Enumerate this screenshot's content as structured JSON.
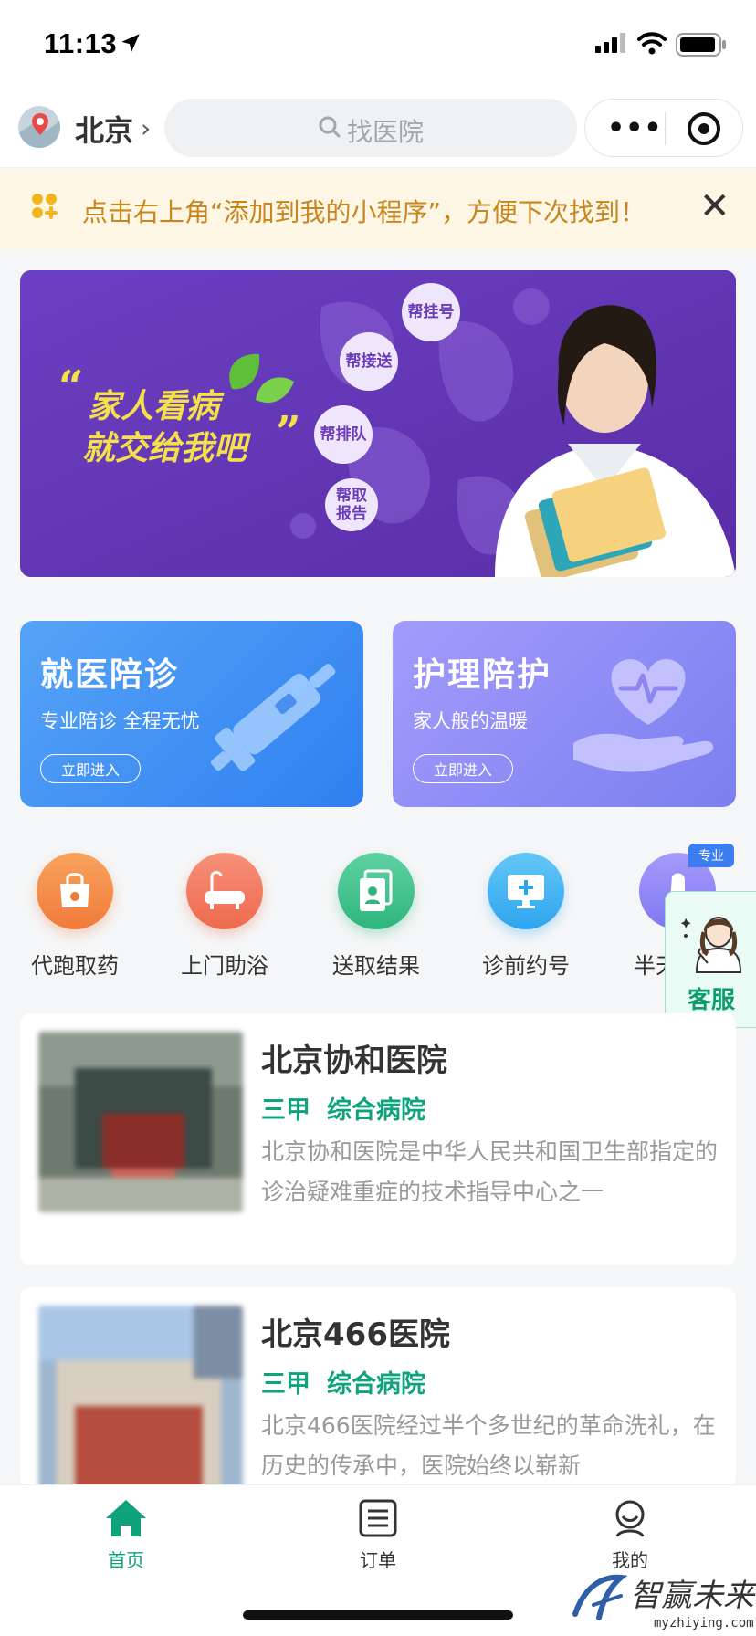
{
  "status_bar": {
    "time": "11:13"
  },
  "top_nav": {
    "city": "北京",
    "search_placeholder": "找医院"
  },
  "notice": {
    "text": "点击右上角“添加到我的小程序”，方便下次找到！"
  },
  "banner": {
    "quote_open": "“",
    "quote_close": "”",
    "line1": "家人看病",
    "line2": "就交给我吧",
    "bubbles": [
      "帮挂号",
      "帮接送",
      "帮排队",
      "帮取报告"
    ]
  },
  "services": [
    {
      "title": "就医陪诊",
      "subtitle": "专业陪诊 全程无忧",
      "button": "立即进入"
    },
    {
      "title": "护理陪护",
      "subtitle": "家人般的温暖",
      "button": "立即进入"
    }
  ],
  "grid": {
    "badge": "专业",
    "items": [
      {
        "label": "代跑取药",
        "icon": "medicine-bag-icon",
        "color": "#f5934d"
      },
      {
        "label": "上门助浴",
        "icon": "bathtub-icon",
        "color": "#f27a5e"
      },
      {
        "label": "送取结果",
        "icon": "report-doc-icon",
        "color": "#3fc08e"
      },
      {
        "label": "诊前约号",
        "icon": "monitor-cross-icon",
        "color": "#3db3f2"
      },
      {
        "label": "半天",
        "icon": "hand-icon",
        "color": "#8d84f3"
      }
    ]
  },
  "kefu": {
    "label": "客服"
  },
  "hospitals": [
    {
      "name": "北京协和医院",
      "tags": [
        "三甲",
        "综合病院"
      ],
      "description": "北京协和医院是中华人民共和国卫生部指定的诊治疑难重症的技术指导中心之一"
    },
    {
      "name": "北京466医院",
      "tags": [
        "三甲",
        "综合病院"
      ],
      "description": "北京466医院经过半个多世纪的革命洗礼，在历史的传承中，医院始终以崭新"
    }
  ],
  "tabbar": {
    "items": [
      {
        "label": "首页",
        "active": true
      },
      {
        "label": "订单",
        "active": false
      },
      {
        "label": "我的",
        "active": false
      }
    ],
    "active_color": "#0ea37c"
  },
  "watermark": {
    "brand": "智赢未来",
    "url": "myzhiying.com"
  }
}
